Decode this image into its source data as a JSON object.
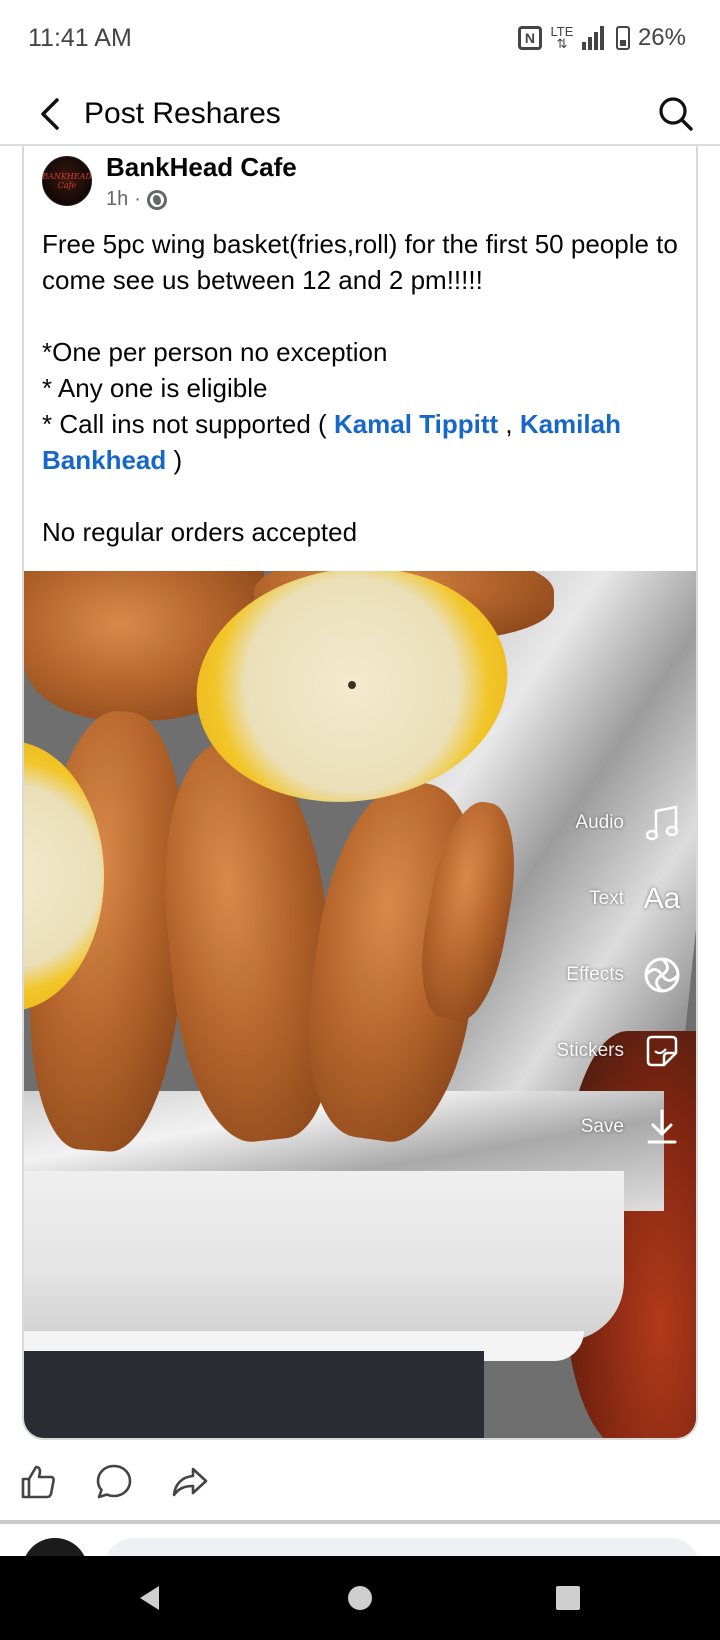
{
  "status_bar": {
    "time": "11:41 AM",
    "network": "LTE",
    "battery": "26%"
  },
  "header": {
    "title": "Post Reshares"
  },
  "post": {
    "author": "BankHead Cafe",
    "avatar_text": "BANKHEAD Cafe",
    "time_ago": "1h",
    "separator": "·",
    "line1": "Free 5pc wing basket(fries,roll) for the first 50 people to come see us between 12 and 2 pm!!!!!",
    "line2": "*One per person no exception",
    "line3": "* Any one is eligible",
    "line4_prefix": "* Call ins not supported ( ",
    "mention1": "Kamal Tippitt",
    "mention_sep": " , ",
    "mention2": "Kamilah Bankhead",
    "line4_suffix": " )",
    "line5": "No regular orders accepted"
  },
  "image_overlay": {
    "items": [
      {
        "label": "Audio",
        "icon": "music-note-icon"
      },
      {
        "label": "Text",
        "icon": "text-aa-icon"
      },
      {
        "label": "Effects",
        "icon": "effects-swirl-icon"
      },
      {
        "label": "Stickers",
        "icon": "sticker-icon"
      },
      {
        "label": "Save",
        "icon": "download-icon"
      }
    ],
    "text_glyph": "Aa"
  },
  "actions": {
    "like_icon": "thumbs-up-icon",
    "comment_icon": "comment-bubble-icon",
    "share_icon": "share-arrow-icon"
  },
  "colors": {
    "mention": "#1766c9",
    "meta": "#65676b",
    "nav_bar": "#000000"
  }
}
